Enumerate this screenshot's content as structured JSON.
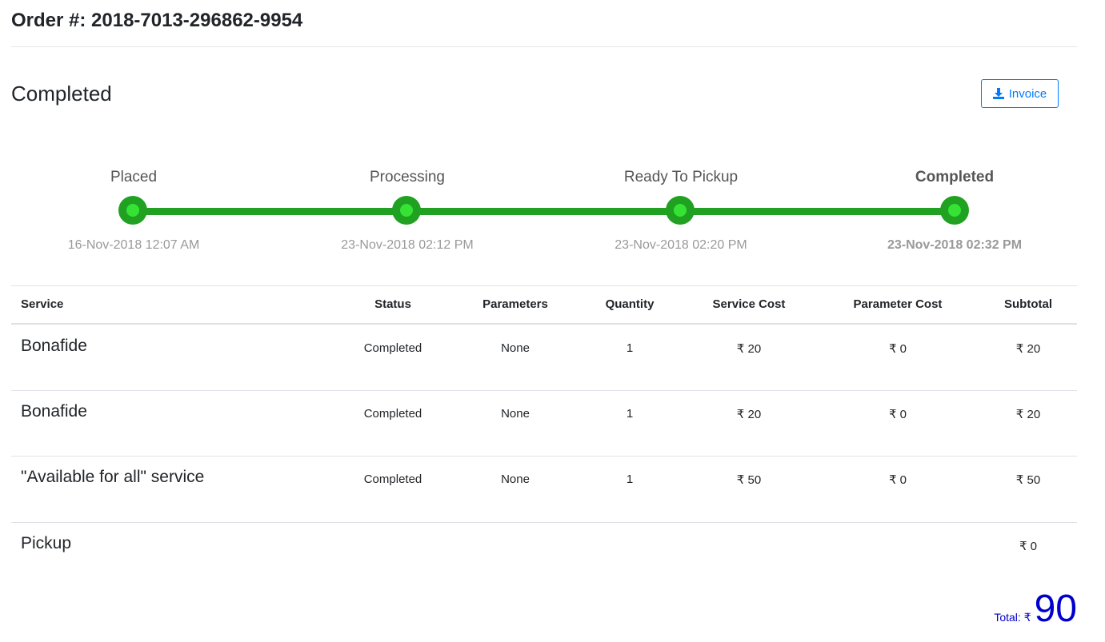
{
  "order": {
    "title": "Order #: 2018-7013-296862-9954"
  },
  "status": {
    "heading": "Completed"
  },
  "invoice_button": {
    "label": "Invoice",
    "icon": "download-icon"
  },
  "timeline": {
    "line_color": "#21a121",
    "dot_color": "#35e335",
    "steps": [
      {
        "label": "Placed",
        "date": "16-Nov-2018 12:07 AM",
        "current": false
      },
      {
        "label": "Processing",
        "date": "23-Nov-2018 02:12 PM",
        "current": false
      },
      {
        "label": "Ready To Pickup",
        "date": "23-Nov-2018 02:20 PM",
        "current": false
      },
      {
        "label": "Completed",
        "date": "23-Nov-2018 02:32 PM",
        "current": true
      }
    ]
  },
  "table": {
    "headers": [
      "Service",
      "Status",
      "Parameters",
      "Quantity",
      "Service Cost",
      "Parameter Cost",
      "Subtotal"
    ],
    "rows": [
      {
        "service": "Bonafide",
        "status": "Completed",
        "parameters": "None",
        "quantity": "1",
        "service_cost": "₹ 20",
        "parameter_cost": "₹ 0",
        "subtotal": "₹ 20"
      },
      {
        "service": "Bonafide",
        "status": "Completed",
        "parameters": "None",
        "quantity": "1",
        "service_cost": "₹ 20",
        "parameter_cost": "₹ 0",
        "subtotal": "₹ 20"
      },
      {
        "service": "\"Available for all\" service",
        "status": "Completed",
        "parameters": "None",
        "quantity": "1",
        "service_cost": "₹ 50",
        "parameter_cost": "₹ 0",
        "subtotal": "₹ 50"
      }
    ],
    "pickup": {
      "label": "Pickup",
      "subtotal": "₹ 0"
    }
  },
  "total": {
    "label": "Total: ₹",
    "value": "90",
    "color": "#0000cc"
  }
}
